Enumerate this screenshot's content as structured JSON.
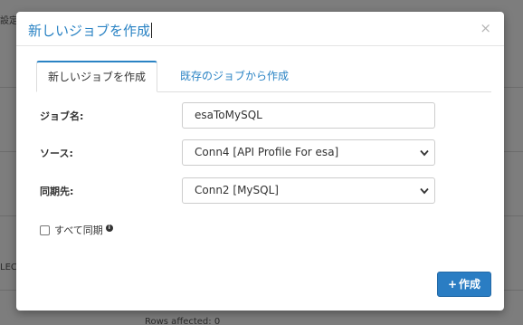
{
  "background": {
    "top_left_text": "設定",
    "left_mid_text": "LEC",
    "bottom_text": "Rows affected: 0"
  },
  "modal": {
    "title": "新しいジョブを作成",
    "close_icon": "×",
    "tabs": [
      {
        "label": "新しいジョブを作成",
        "active": true
      },
      {
        "label": "既存のジョブから作成",
        "active": false
      }
    ],
    "fields": {
      "job_name": {
        "label": "ジョブ名:",
        "value": "esaToMySQL"
      },
      "source": {
        "label": "ソース:",
        "value": "Conn4 [API Profile For esa]"
      },
      "sync_target": {
        "label": "同期先:",
        "value": "Conn2 [MySQL]"
      }
    },
    "sync_all": {
      "label": "すべて同期",
      "info_icon": "i",
      "checked": false
    },
    "create_button": {
      "icon": "+",
      "label": "作成"
    }
  },
  "colors": {
    "accent": "#2a83c4",
    "button_bg": "#2a7dc3",
    "overlay": "#7d7d7d"
  }
}
